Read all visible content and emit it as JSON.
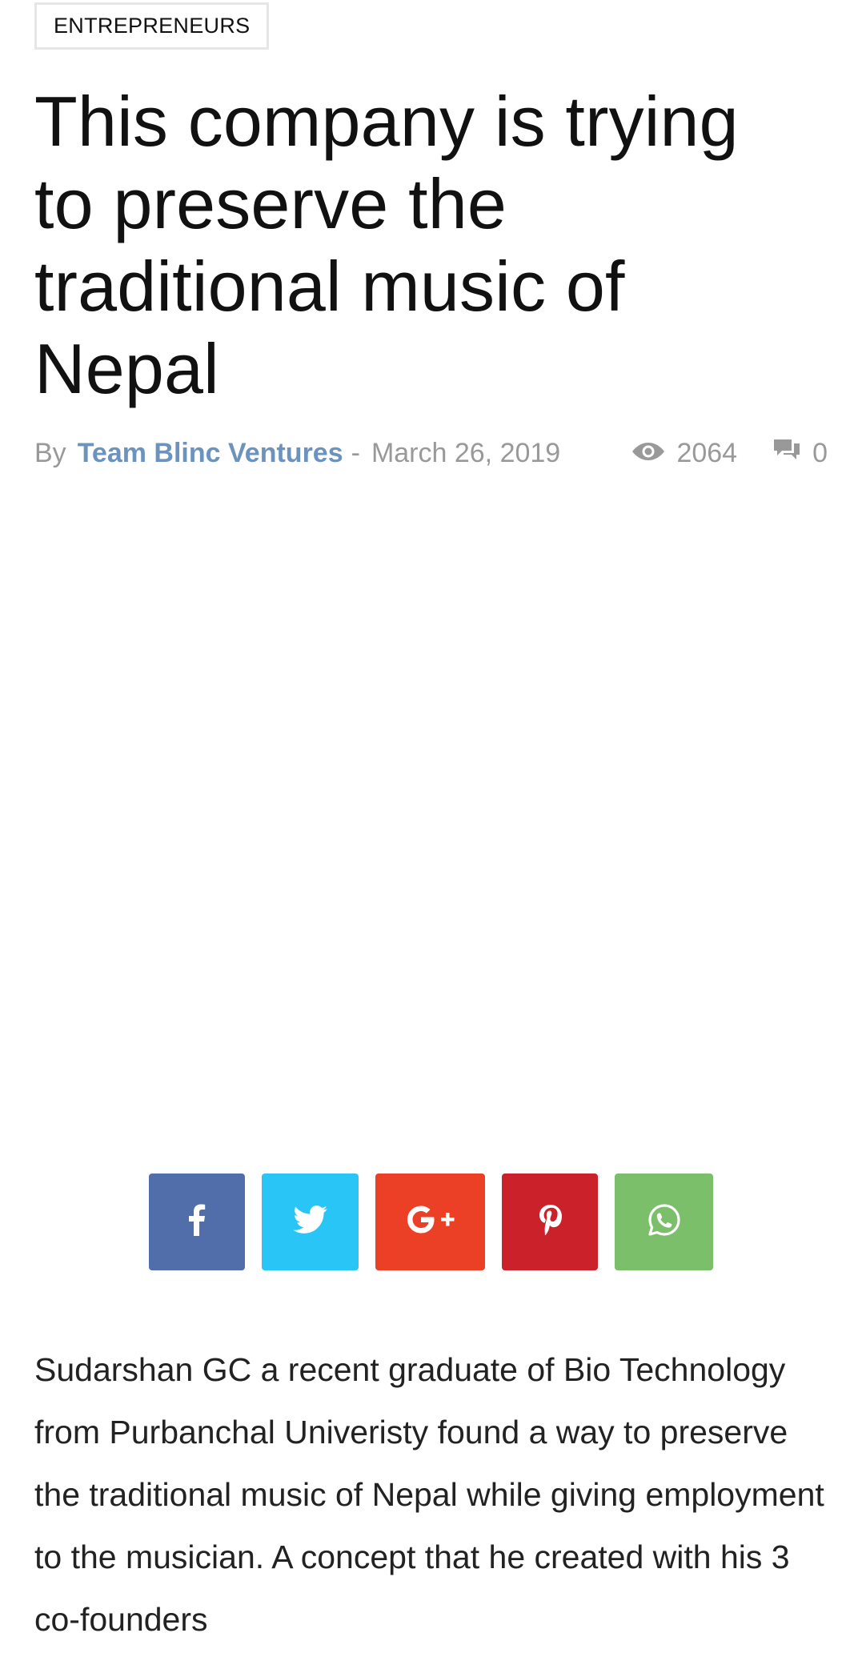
{
  "article": {
    "category": "ENTREPRENEURS",
    "title": "This company is trying to preserve the traditional music of Nepal",
    "meta": {
      "by_label": "By",
      "author": "Team Blinc Ventures",
      "separator": "-",
      "date": "March 26, 2019",
      "views": "2064",
      "comments": "0"
    },
    "body": "Sudarshan GC a recent graduate of Bio Technology from Purbanchal Univeristy found a way to preserve the traditional music of Nepal while giving employment to the musician. A concept that he created with his 3 co-founders"
  },
  "share": {
    "buttons": [
      {
        "network": "facebook",
        "icon": "facebook-icon",
        "color": "#516eab"
      },
      {
        "network": "twitter",
        "icon": "twitter-icon",
        "color": "#29c5f6"
      },
      {
        "network": "googleplus",
        "icon": "google-plus-icon",
        "color": "#eb4026"
      },
      {
        "network": "pinterest",
        "icon": "pinterest-icon",
        "color": "#ca212a"
      },
      {
        "network": "whatsapp",
        "icon": "whatsapp-icon",
        "color": "#7bbf6a"
      }
    ]
  },
  "colors": {
    "author_link": "#6b93be",
    "meta_text": "#999999",
    "title_text": "#111111",
    "body_text": "#222222"
  }
}
